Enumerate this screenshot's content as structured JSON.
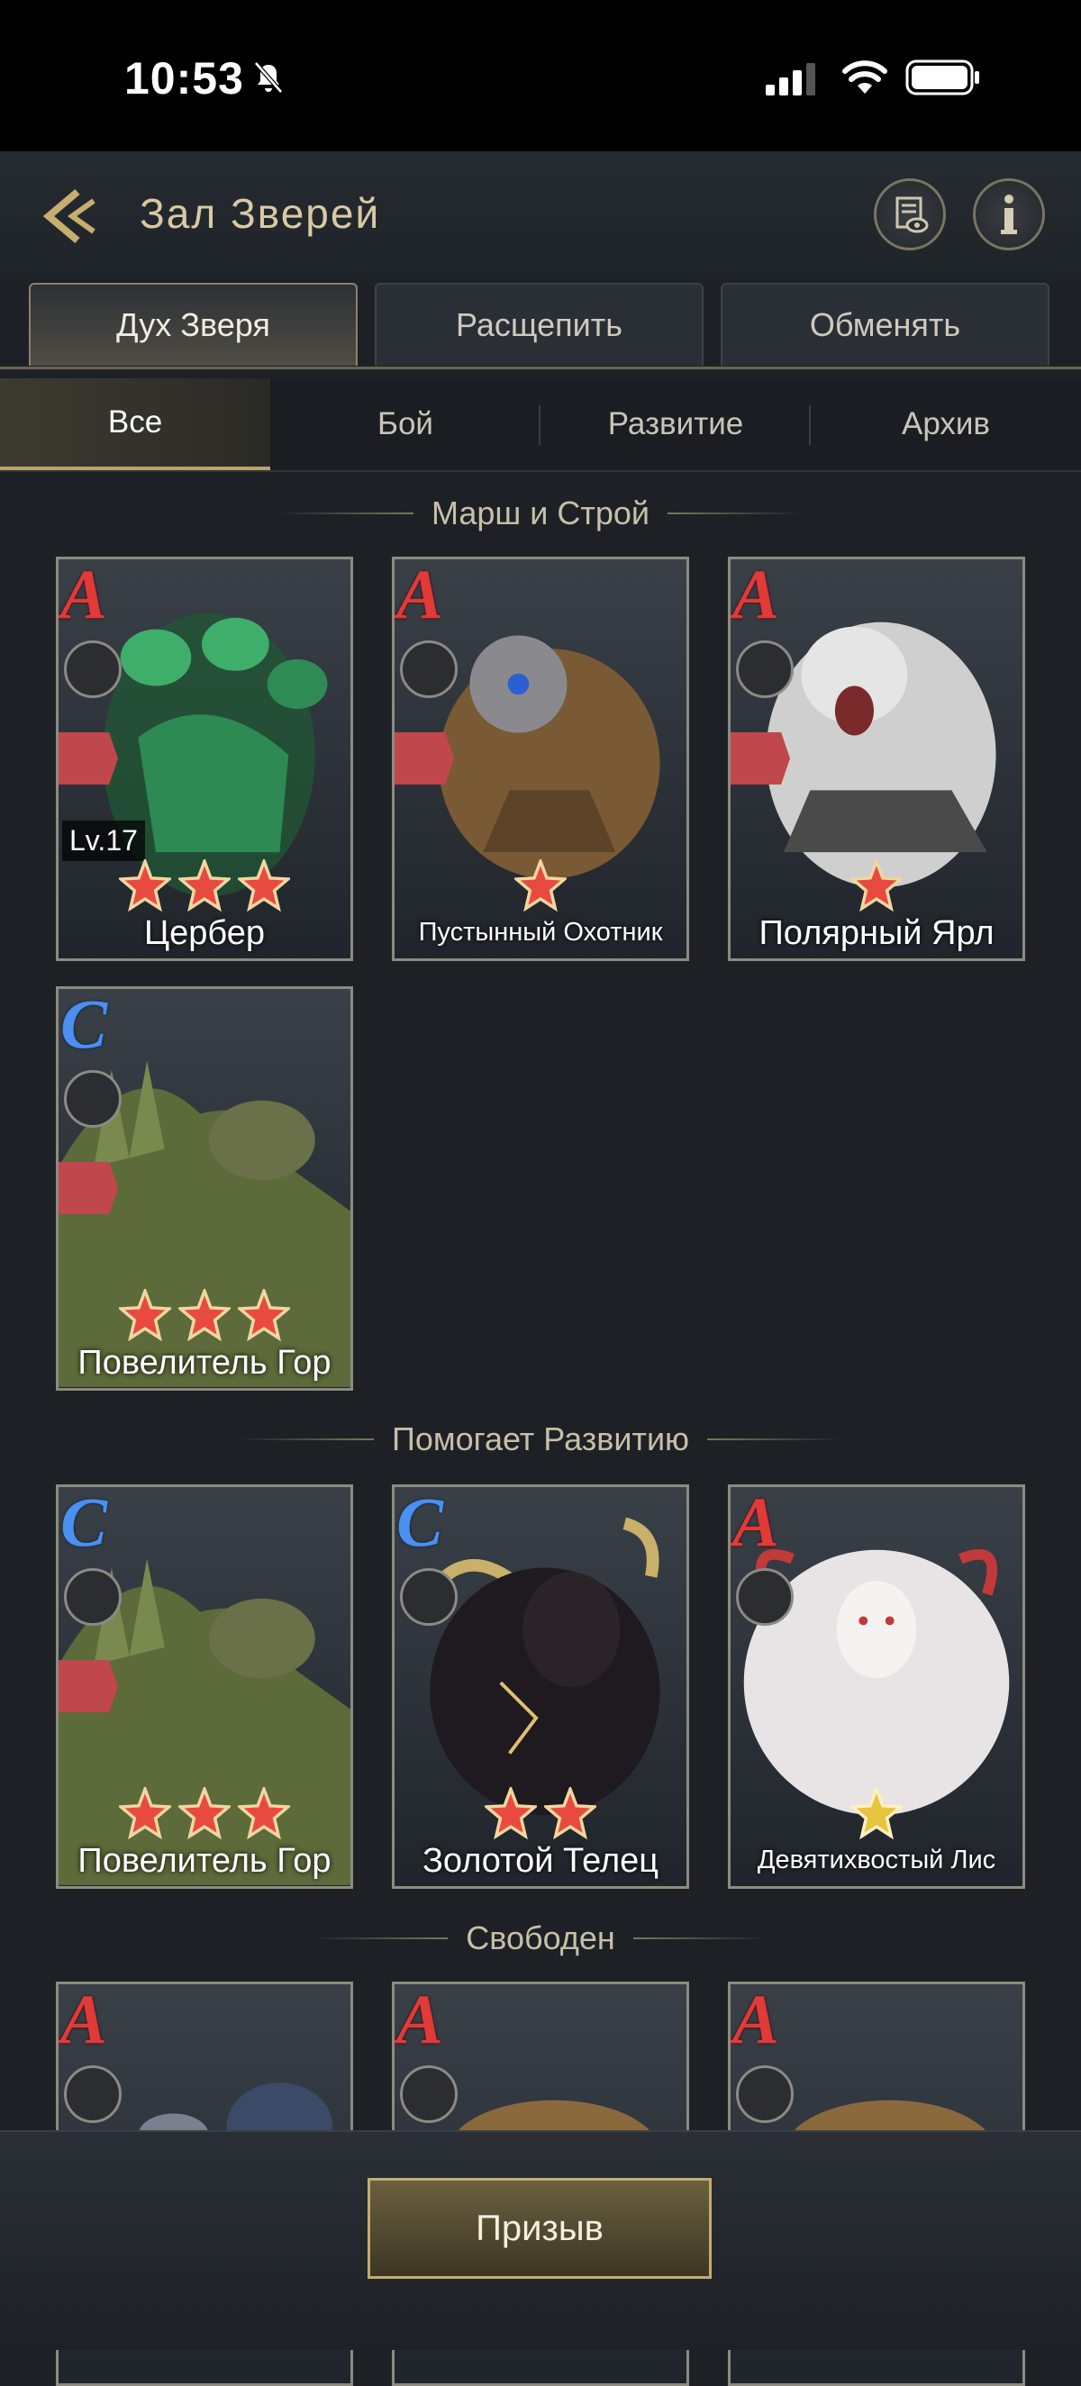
{
  "status_bar": {
    "time": "10:53"
  },
  "header": {
    "title": "Зал Зверей"
  },
  "tabs_main": [
    "Дух Зверя",
    "Расщепить",
    "Обменять"
  ],
  "tabs_filter": [
    "Все",
    "Бой",
    "Развитие",
    "Архив"
  ],
  "sections": [
    {
      "title": "Марш и Строй"
    },
    {
      "title": "Помогает Развитию"
    },
    {
      "title": "Свободен"
    }
  ],
  "cards": [
    {
      "name": "Цербер",
      "grade": "A",
      "level": "Lv.17",
      "stars": 3
    },
    {
      "name": "Пустынный Охотник",
      "grade": "A",
      "stars": 1
    },
    {
      "name": "Полярный Ярл",
      "grade": "A",
      "stars": 1
    },
    {
      "name": "Повелитель Гор",
      "grade": "C",
      "stars": 3
    },
    {
      "name": "Повелитель Гор",
      "grade": "C",
      "stars": 3
    },
    {
      "name": "Золотой Телец",
      "grade": "C",
      "stars": 2
    },
    {
      "name": "Девятихвостый Лис",
      "grade": "A",
      "stars": 1
    },
    {
      "grade": "A"
    },
    {
      "grade": "A"
    },
    {
      "grade": "A"
    }
  ],
  "summon_button": "Призыв",
  "colors": {
    "accent_gold": "#c3ad6e",
    "grade_a": "#e23a38",
    "grade_c": "#4b8ff0",
    "star": "#e84a3f"
  }
}
